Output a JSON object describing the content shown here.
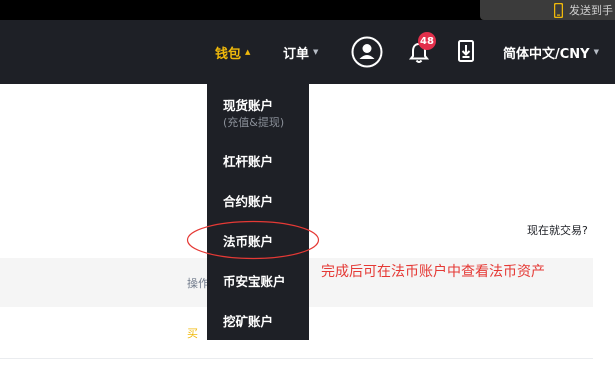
{
  "top_strip": {
    "right_text": "发送到手"
  },
  "navbar": {
    "wallet": "钱包",
    "orders": "订单",
    "notification_count": "48",
    "language_currency": "简体中文/CNY"
  },
  "wallet_menu": {
    "items": [
      {
        "label": "现货账户",
        "sublabel": "(充值&提现)"
      },
      {
        "label": "杠杆账户"
      },
      {
        "label": "合约账户"
      },
      {
        "label": "法币账户"
      },
      {
        "label": "币安宝账户"
      },
      {
        "label": "挖矿账户"
      }
    ]
  },
  "page": {
    "hint": "现在就交易?",
    "op_header": "操作",
    "buy": "买"
  },
  "annotation": {
    "text": "完成后可在法币账户中查看法币资产",
    "color": "#e53935"
  },
  "colors": {
    "brand": "#f0b90b",
    "nav_bg": "#1e2026",
    "badge": "#e22f4b"
  }
}
